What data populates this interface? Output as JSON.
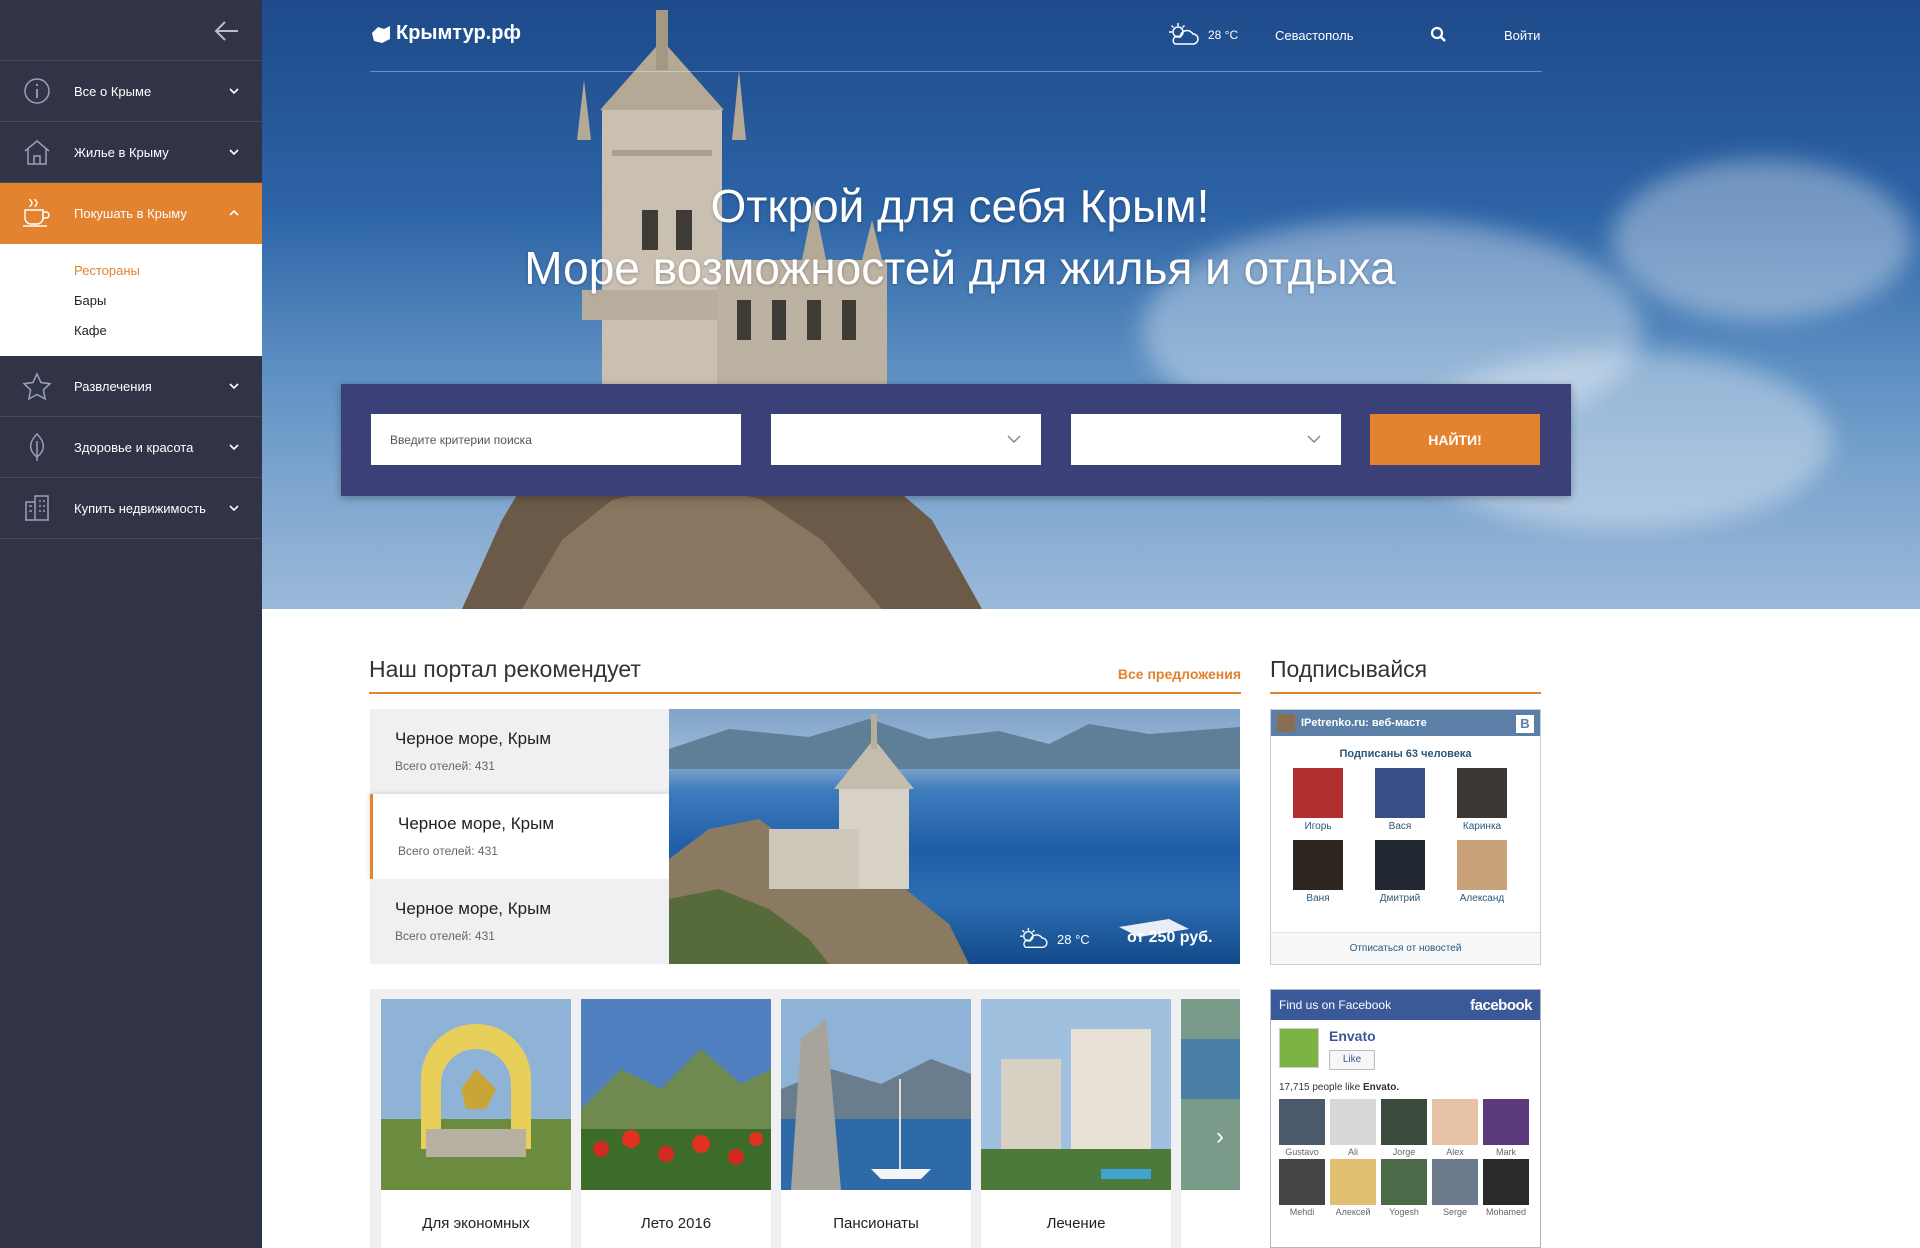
{
  "sidebar": {
    "items": [
      {
        "label": "Все о Крыме",
        "icon": "info-icon"
      },
      {
        "label": "Жилье в Крыму",
        "icon": "house-icon"
      },
      {
        "label": "Покушать в Крыму",
        "icon": "coffee-cup-icon",
        "active": true,
        "sub": [
          "Рестораны",
          "Бары",
          "Кафе"
        ]
      },
      {
        "label": "Развлечения",
        "icon": "star-icon"
      },
      {
        "label": "Здоровье и красота",
        "icon": "leaf-icon"
      },
      {
        "label": "Купить недвижимость",
        "icon": "building-icon"
      }
    ]
  },
  "header": {
    "logo": "Крымтур.рф",
    "temp": "28 °C",
    "city": "Севастополь",
    "login": "Войти"
  },
  "hero": {
    "line1": "Открой для себя Крым!",
    "line2": "Море возможностей для жилья и отдыха"
  },
  "search": {
    "placeholder": "Введите критерии поиска",
    "button": "НАЙТИ!"
  },
  "recommend": {
    "title": "Наш портал рекомендует",
    "all": "Все предложения",
    "items": [
      {
        "name": "Черное море, Крым",
        "count": "Всего отелей: 431"
      },
      {
        "name": "Черное море, Крым",
        "count": "Всего отелей: 431"
      },
      {
        "name": "Черное море, Крым",
        "count": "Всего отелей: 431"
      }
    ],
    "temp": "28 °C",
    "price": "от 250 руб."
  },
  "cards": [
    {
      "title": "Для экономных"
    },
    {
      "title": "Лето 2016"
    },
    {
      "title": "Пансионаты"
    },
    {
      "title": "Лечение"
    }
  ],
  "subscribe": {
    "title": "Подписывайся",
    "vk": {
      "group": "IPetrenko.ru: веб-масте",
      "badge": "B",
      "count": "Подписаны 63 человека",
      "users": [
        "Игорь",
        "Вася",
        "Каринка",
        "Ваня",
        "Дмитрий",
        "Александ"
      ],
      "footer": "Отписаться от новостей"
    },
    "fb": {
      "header": "Find us on Facebook",
      "brand": "facebook",
      "page": "Envato",
      "like": "Like",
      "count_prefix": "17,715 people like ",
      "count_name": "Envato.",
      "users": [
        "Gustavo",
        "Ali",
        "Jorge",
        "Alex",
        "Mark",
        "Mehdi",
        "Алексей",
        "Yogesh",
        "Serge",
        "Mohamed"
      ]
    }
  }
}
